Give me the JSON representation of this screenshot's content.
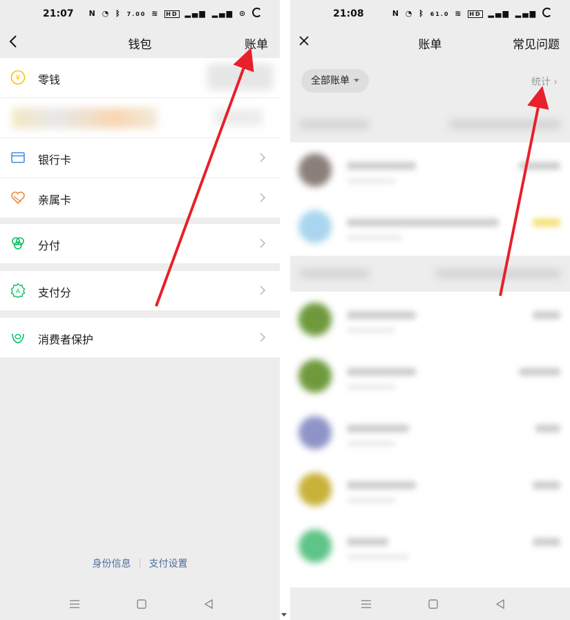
{
  "left": {
    "status": {
      "time": "21:07",
      "net_speed": "7.00"
    },
    "title": "钱包",
    "bill_link": "账单",
    "items": [
      {
        "label": "零钱",
        "icon": "coin-icon"
      },
      {
        "label": "",
        "icon": "blurred-icon"
      },
      {
        "label": "银行卡",
        "icon": "bank-card-icon"
      },
      {
        "label": "亲属卡",
        "icon": "family-card-icon"
      },
      {
        "label": "分付",
        "icon": "installment-icon"
      },
      {
        "label": "支付分",
        "icon": "payscore-icon"
      },
      {
        "label": "消费者保护",
        "icon": "consumer-protection-icon"
      }
    ],
    "footer": {
      "identity": "身份信息",
      "payment_settings": "支付设置"
    }
  },
  "right": {
    "status": {
      "time": "21:08",
      "net_speed": "61.0"
    },
    "title": "账单",
    "faq_link": "常见问题",
    "filter_label": "全部账单",
    "stats_label": "统计"
  },
  "colors": {
    "accent_green": "#07c160",
    "coin_yellow": "#f5c400",
    "link_blue": "#4f6e9c",
    "arrow_red": "#e8202a",
    "bank_blue": "#3a8de0",
    "family_orange": "#f08a3c"
  }
}
